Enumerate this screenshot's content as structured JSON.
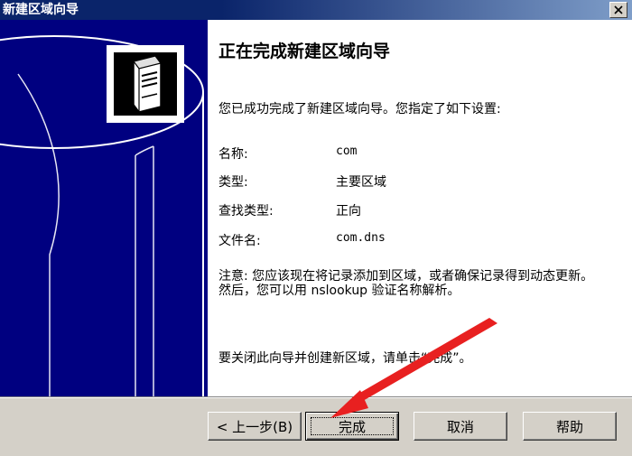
{
  "window": {
    "title": "新建区域向导"
  },
  "page": {
    "heading": "正在完成新建区域向导",
    "intro": "您已成功完成了新建区域向导。您指定了如下设置:",
    "settings": [
      {
        "label": "名称:",
        "value": "com"
      },
      {
        "label": "类型:",
        "value": "主要区域"
      },
      {
        "label": "查找类型:",
        "value": "正向"
      },
      {
        "label": "文件名:",
        "value": "com.dns"
      }
    ],
    "note": "注意: 您应该现在将记录添加到区域，或者确保记录得到动态更新。然后，您可以用 nslookup 验证名称解析。",
    "closing": "要关闭此向导并创建新区域，请单击“完成”。"
  },
  "buttons": {
    "back": "< 上一步(B)",
    "finish": "完成",
    "cancel": "取消",
    "help": "帮助"
  },
  "icons": {
    "banner": "server-icon",
    "close": "close-icon",
    "annotation": "red-arrow-icon"
  },
  "colors": {
    "banner": "#000080",
    "titlebar": "#0a246a",
    "annotation_arrow": "#e82020"
  }
}
